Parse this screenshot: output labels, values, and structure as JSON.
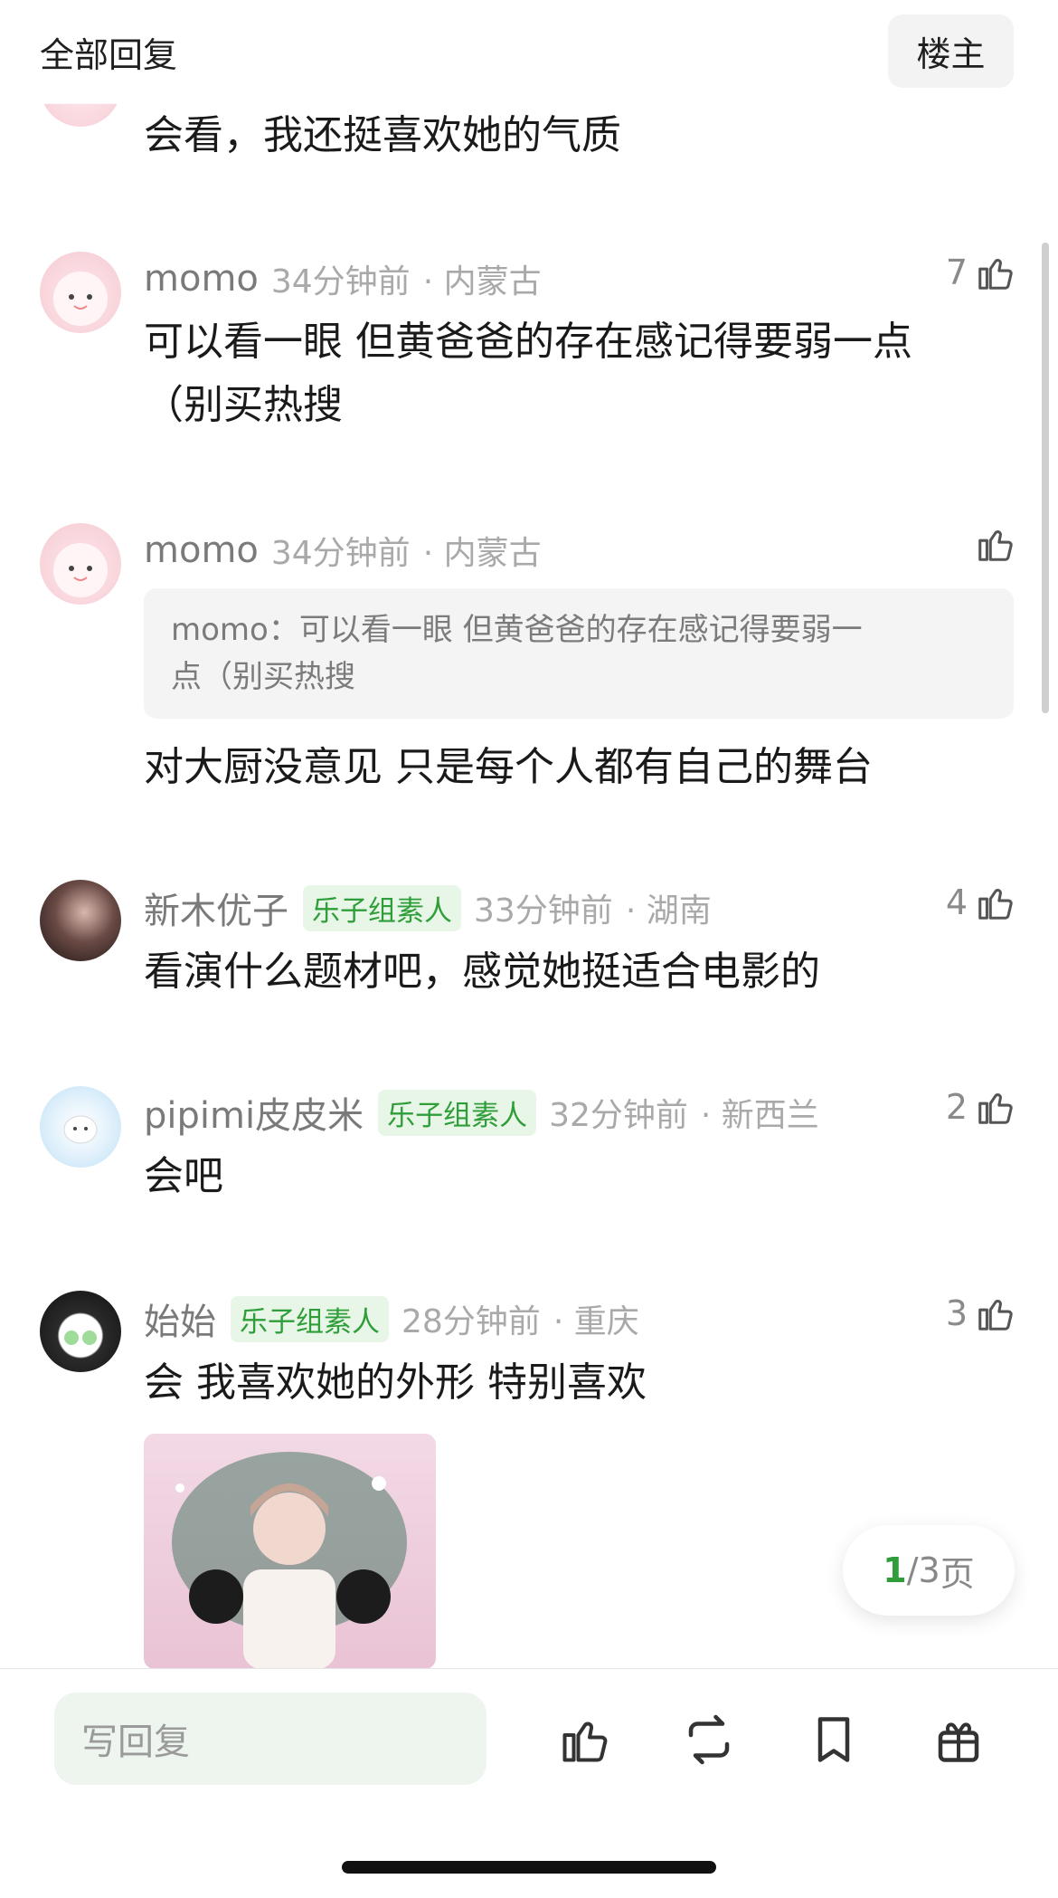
{
  "header": {
    "title": "全部回复",
    "owner_button": "楼主"
  },
  "previous_comment": {
    "text": "会看，我还挺喜欢她的气质"
  },
  "comments": [
    {
      "username": "momo",
      "time": "34分钟前",
      "location": "· 内蒙古",
      "likes": "7",
      "lines": [
        "可以看一眼 但黄爸爸的存在感记得要弱一点",
        "（别买热搜"
      ]
    },
    {
      "username": "momo",
      "time": "34分钟前",
      "location": "· 内蒙古",
      "likes": "",
      "quote": [
        "momo：可以看一眼 但黄爸爸的存在感记得要弱一",
        "点（别买热搜"
      ],
      "text": "对大厨没意见 只是每个人都有自己的舞台"
    },
    {
      "username": "新木优子",
      "badge": "乐子组素人",
      "time": "33分钟前",
      "location": "· 湖南",
      "likes": "4",
      "text": "看演什么题材吧，感觉她挺适合电影的"
    },
    {
      "username": "pipimi皮皮米",
      "badge": "乐子组素人",
      "time": "32分钟前",
      "location": "· 新西兰",
      "likes": "2",
      "text": "会吧"
    },
    {
      "username": "始始",
      "badge": "乐子组素人",
      "time": "28分钟前",
      "location": "· 重庆",
      "likes": "3",
      "text": "会 我喜欢她的外形 特别喜欢"
    }
  ],
  "pagination": {
    "current": "1",
    "total": "/3",
    "unit": " 页"
  },
  "bottom_bar": {
    "reply_placeholder": "写回复"
  },
  "colors": {
    "accent_green": "#2f9e3a",
    "badge_bg": "#e7f6e6"
  },
  "icons": [
    "thumbs-up-icon",
    "repost-icon",
    "bookmark-icon",
    "gift-icon"
  ]
}
